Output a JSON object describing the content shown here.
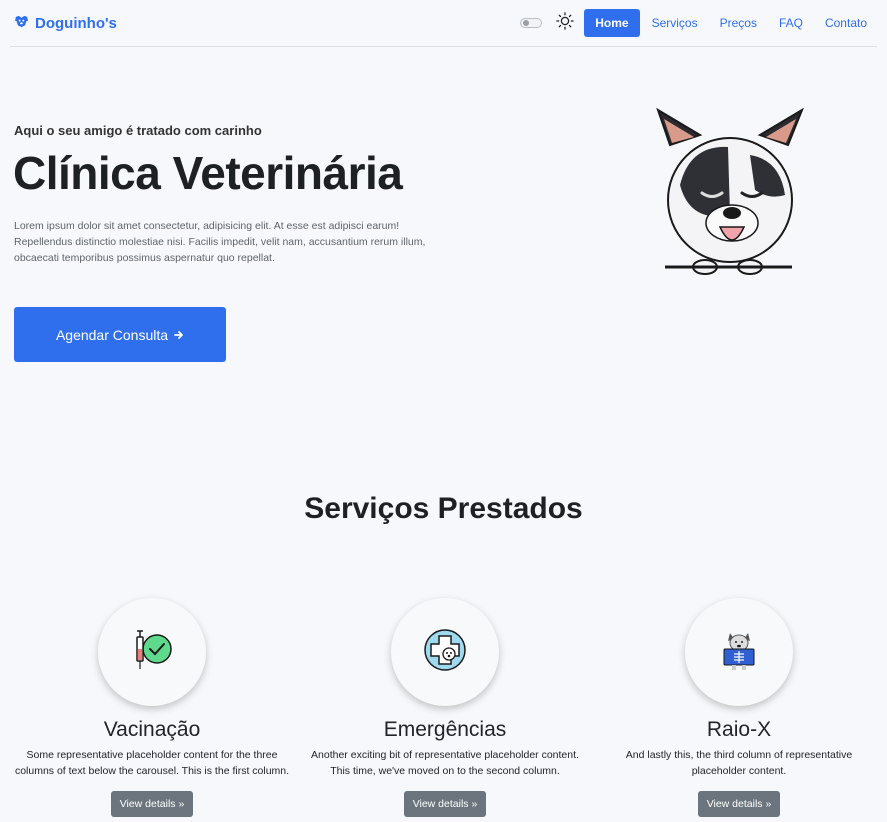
{
  "brand": {
    "name": "Doguinho's",
    "icon": "dog-icon"
  },
  "nav": {
    "theme_toggle_icon": "toggle-switch-icon",
    "theme_icon": "sun-icon",
    "links": [
      "Home",
      "Serviços",
      "Preços",
      "FAQ",
      "Contato"
    ],
    "active": "Home"
  },
  "hero": {
    "subtitle": "Aqui o seu amigo é tratado com carinho",
    "title": "Clínica Veterinária",
    "text": "Lorem ipsum dolor sit amet consectetur, adipisicing elit. At esse est adipisci earum! Repellendus distinctio molestiae nisi. Facilis impedit, velit nam, accusantium rerum illum, obcaecati temporibus possimus aspernatur quo repellat.",
    "cta_label": "Agendar Consulta",
    "cta_icon": "arrow-right-icon"
  },
  "services": {
    "title": "Serviços Prestados",
    "items": [
      {
        "icon": "vaccine-icon",
        "title": "Vacinação",
        "text": "Some representative placeholder content for the three columns of text below the carousel. This is the first column.",
        "button": "View details »"
      },
      {
        "icon": "emergency-cross-icon",
        "title": "Emergências",
        "text": "Another exciting bit of representative placeholder content. This time, we've moved on to the second column.",
        "button": "View details »"
      },
      {
        "icon": "xray-dog-icon",
        "title": "Raio-X",
        "text": "And lastly this, the third column of representative placeholder content.",
        "button": "View details »"
      }
    ]
  },
  "colors": {
    "primary": "#2f6fed",
    "secondary": "#6c757d",
    "background": "#f6f8fb"
  }
}
